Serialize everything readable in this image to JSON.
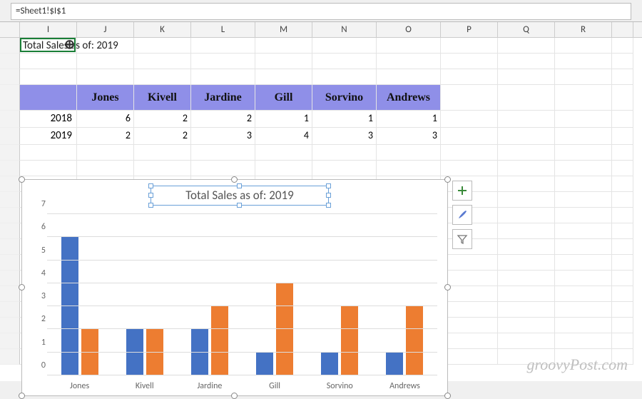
{
  "formula_bar": "=Sheet1!$I$1",
  "columns": [
    "I",
    "J",
    "K",
    "L",
    "M",
    "N",
    "O",
    "P",
    "Q",
    "R"
  ],
  "title_cell": "Total Sales as of: 2019",
  "active_cell": "I1",
  "table": {
    "headers": [
      "Jones",
      "Kivell",
      "Jardine",
      "Gill",
      "Sorvino",
      "Andrews"
    ],
    "rows": [
      {
        "label": "2018",
        "values": [
          6,
          2,
          2,
          1,
          1,
          1
        ]
      },
      {
        "label": "2019",
        "values": [
          2,
          2,
          3,
          4,
          3,
          3
        ]
      }
    ]
  },
  "chart_data": {
    "type": "bar",
    "title": "Total Sales as of: 2019",
    "categories": [
      "Jones",
      "Kivell",
      "Jardine",
      "Gill",
      "Sorvino",
      "Andrews"
    ],
    "series": [
      {
        "name": "2018",
        "values": [
          6,
          2,
          2,
          1,
          1,
          1
        ],
        "color": "#4472C4"
      },
      {
        "name": "2019",
        "values": [
          2,
          2,
          3,
          4,
          3,
          3
        ],
        "color": "#ED7D31"
      }
    ],
    "xlabel": "",
    "ylabel": "",
    "ylim": [
      0,
      7
    ],
    "y_ticks": [
      0,
      1,
      2,
      3,
      4,
      5,
      6,
      7
    ],
    "grid": true,
    "legend": false
  },
  "side_buttons": {
    "add": "plus-icon",
    "styles": "paintbrush-icon",
    "filter": "funnel-icon"
  },
  "watermark": "groovyPost.com"
}
